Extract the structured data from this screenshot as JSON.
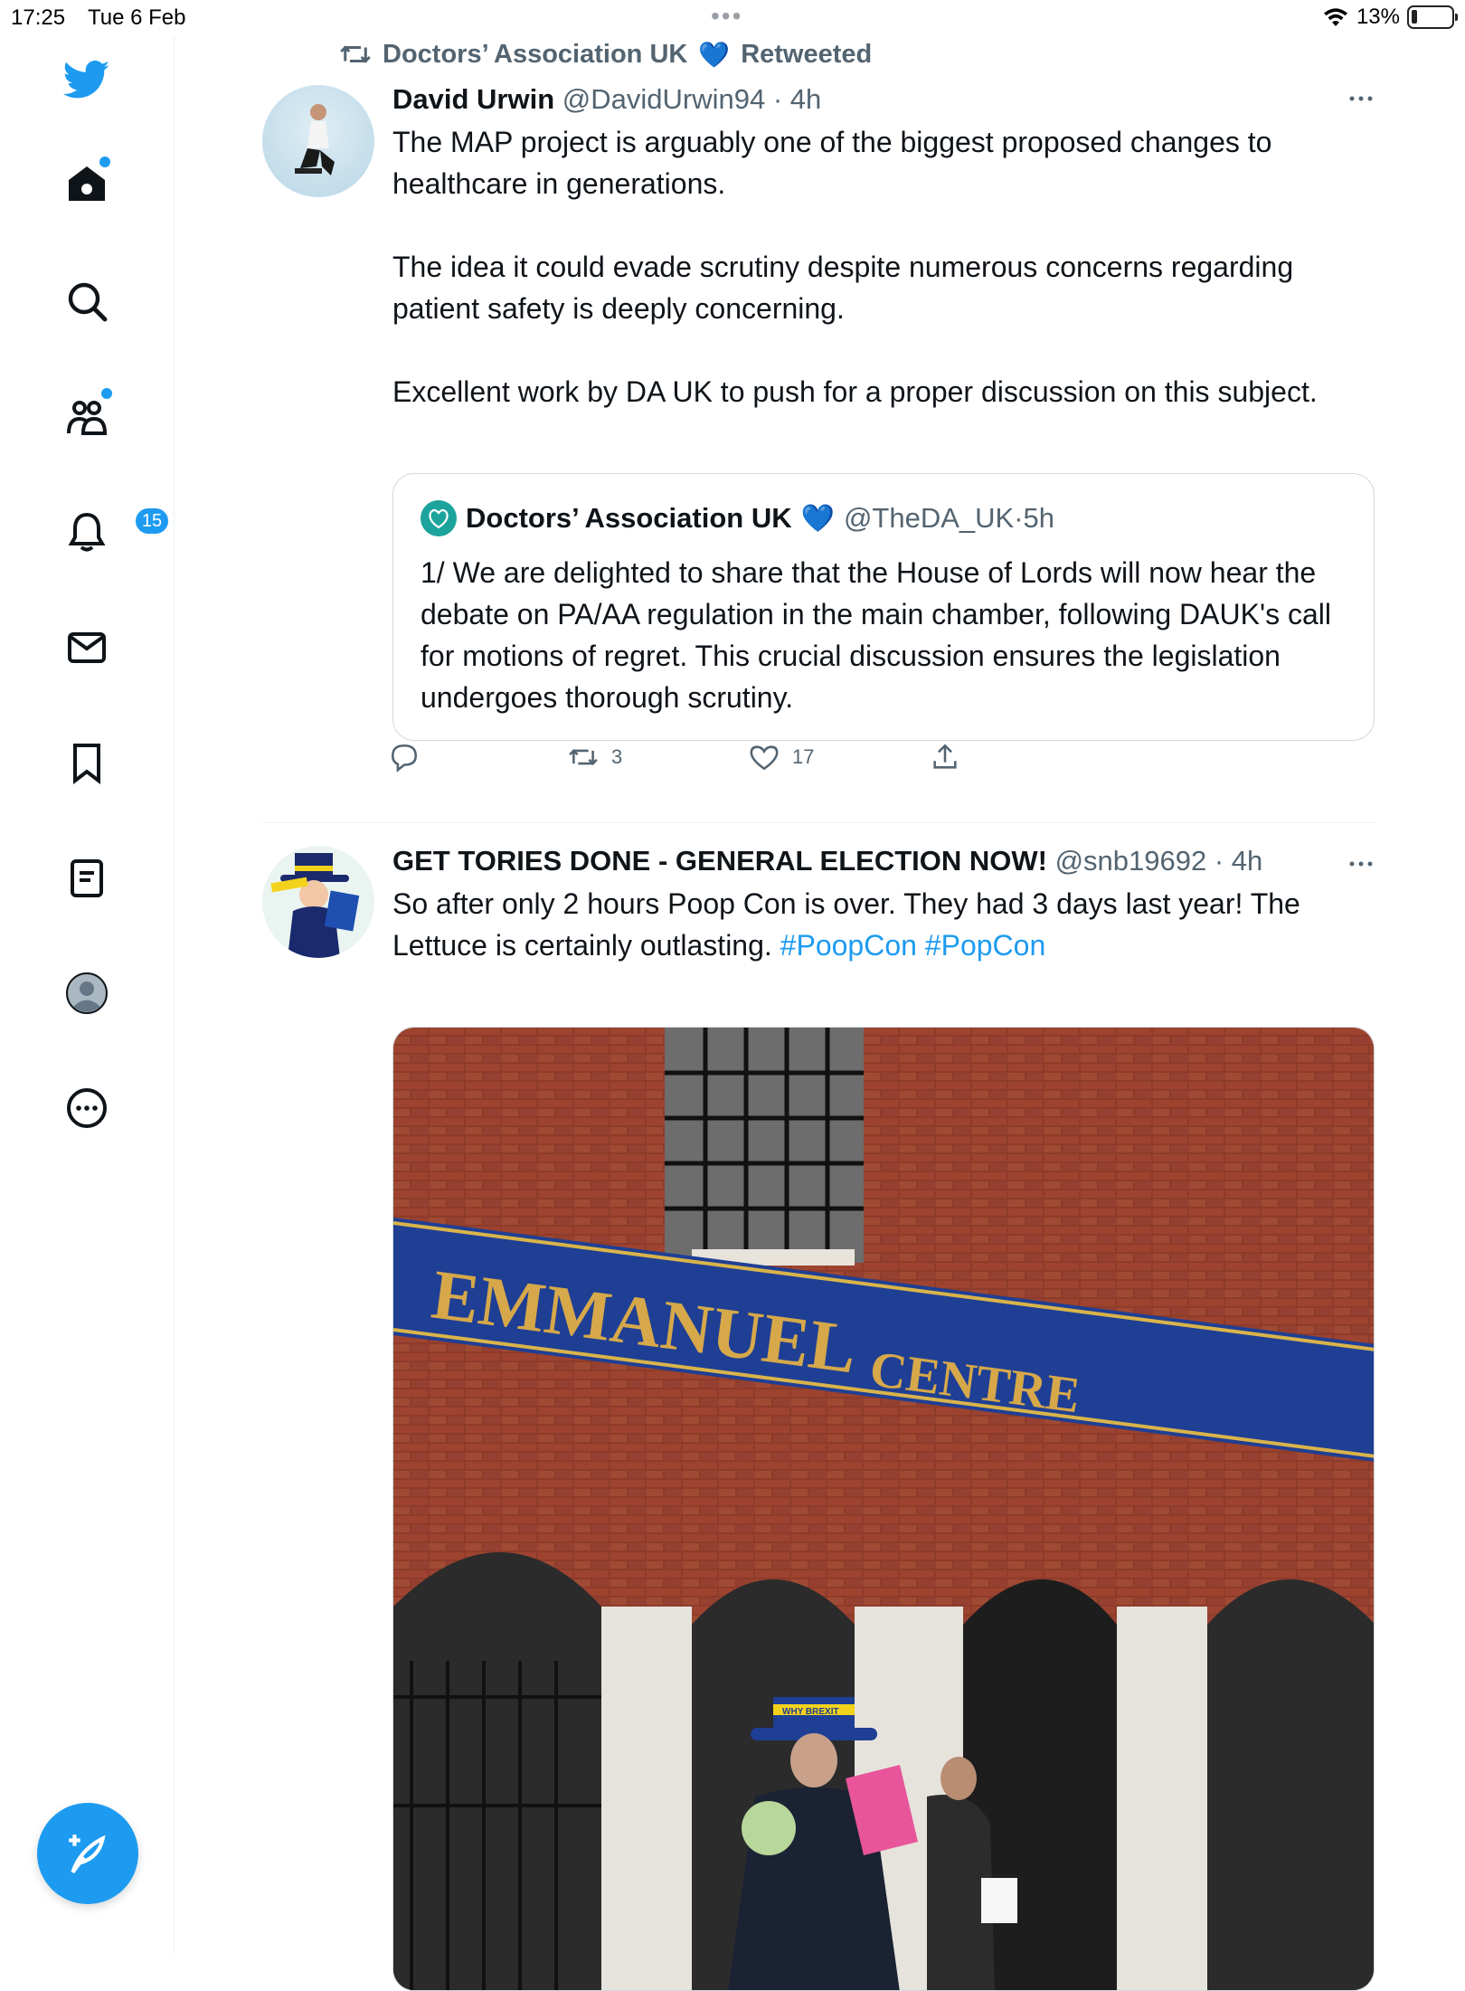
{
  "status_bar": {
    "time": "17:25",
    "date": "Tue 6 Feb",
    "battery": "13%"
  },
  "sidebar": {
    "items": [
      {
        "name": "twitter-logo"
      },
      {
        "name": "home"
      },
      {
        "name": "explore"
      },
      {
        "name": "communities"
      },
      {
        "name": "notifications",
        "badge": "15"
      },
      {
        "name": "messages"
      },
      {
        "name": "bookmarks"
      },
      {
        "name": "lists"
      },
      {
        "name": "profile"
      },
      {
        "name": "more"
      }
    ],
    "accent": "#1d9bf0"
  },
  "tweets": [
    {
      "retweeted_by": "Doctors’ Association UK",
      "retweet_label": "Retweeted",
      "retweeter_badge": "💙",
      "display_name": "David Urwin",
      "handle": "@DavidUrwin94",
      "time": "4h",
      "text": "The MAP project is arguably one of the biggest proposed changes to healthcare in generations.\n\nThe idea it could evade scrutiny despite numerous concerns regarding patient safety is deeply concerning.\n\nExcellent work by DA UK to push for a proper discussion on this subject.",
      "quote": {
        "display_name": "Doctors’ Association UK",
        "badge": "💙",
        "handle": "@TheDA_UK",
        "time": "5h",
        "text": "1/ We are delighted to share that the House of Lords will now hear the debate on PA/AA regulation in the main chamber, following DAUK's call for motions of regret. This crucial discussion ensures the legislation undergoes thorough scrutiny."
      },
      "actions": {
        "replies": "",
        "retweets": "3",
        "likes": "17"
      }
    },
    {
      "display_name": "GET TORIES DONE - GENERAL ELECTION NOW!",
      "handle": "@snb19692",
      "time": "4h",
      "text_before": "So after only 2 hours Poop Con is over. They had 3 days last year! The Lettuce is certainly outlasting. ",
      "hashtags": [
        "#PoopCon",
        "#PopCon"
      ],
      "photo": {
        "sign_word_1": "EMMANUEL",
        "sign_word_2": "CENTRE",
        "hat_text": "WHY BREXIT"
      }
    }
  ]
}
